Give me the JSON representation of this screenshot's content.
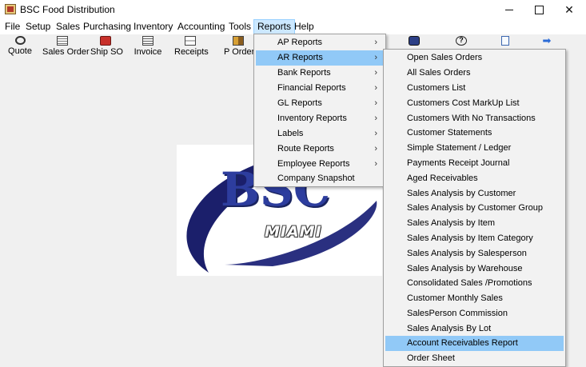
{
  "window": {
    "title": "BSC Food Distribution"
  },
  "menubar": {
    "items": [
      "File",
      "Setup",
      "Sales",
      "Purchasing",
      "Inventory",
      "Accounting",
      "Tools",
      "Reports",
      "Help"
    ],
    "active": "Reports"
  },
  "toolbar": {
    "items": [
      {
        "label": "Quote",
        "icon": "handshake-icon"
      },
      {
        "label": "Sales Order",
        "icon": "document-icon"
      },
      {
        "label": "Ship SO",
        "icon": "truck-icon"
      },
      {
        "label": "Invoice",
        "icon": "invoice-icon"
      },
      {
        "label": "Receipts",
        "icon": "receipt-icon"
      },
      {
        "label": "P Order",
        "icon": "purchase-order-icon"
      },
      {
        "label": "",
        "icon": "gear-icon"
      },
      {
        "label": "",
        "icon": "help-icon"
      },
      {
        "label": "",
        "icon": "page-icon"
      },
      {
        "label": "",
        "icon": "arrow-right-icon"
      }
    ]
  },
  "logo": {
    "main_text": "BSC",
    "sub_text": "MIAMI"
  },
  "reports_menu": {
    "items": [
      {
        "label": "AP Reports",
        "submenu": true
      },
      {
        "label": "AR Reports",
        "submenu": true,
        "highlighted": true
      },
      {
        "label": "Bank Reports",
        "submenu": true
      },
      {
        "label": "Financial Reports",
        "submenu": true
      },
      {
        "label": "GL Reports",
        "submenu": true
      },
      {
        "label": "Inventory Reports",
        "submenu": true
      },
      {
        "label": "Labels",
        "submenu": true
      },
      {
        "label": "Route Reports",
        "submenu": true
      },
      {
        "label": "Employee Reports",
        "submenu": true
      },
      {
        "label": "Company Snapshot",
        "submenu": false
      }
    ]
  },
  "ar_reports_menu": {
    "items": [
      {
        "label": "Open Sales Orders"
      },
      {
        "label": "All Sales Orders"
      },
      {
        "label": "Customers List"
      },
      {
        "label": "Customers Cost MarkUp List"
      },
      {
        "label": "Customers With No Transactions"
      },
      {
        "label": "Customer Statements"
      },
      {
        "label": "Simple Statement / Ledger"
      },
      {
        "label": "Payments Receipt Journal"
      },
      {
        "label": "Aged Receivables"
      },
      {
        "label": "Sales Analysis by Customer"
      },
      {
        "label": "Sales Analysis by Customer Group"
      },
      {
        "label": "Sales Analysis by Item"
      },
      {
        "label": "Sales Analysis by Item Category"
      },
      {
        "label": "Sales Analysis by Salesperson"
      },
      {
        "label": "Sales Analysis by Warehouse"
      },
      {
        "label": "Consolidated Sales /Promotions"
      },
      {
        "label": "Customer Monthly Sales"
      },
      {
        "label": "SalesPerson Commission"
      },
      {
        "label": "Sales Analysis By Lot"
      },
      {
        "label": "Account Receivables Report",
        "highlighted": true
      },
      {
        "label": "Order Sheet"
      }
    ]
  },
  "submenu_arrow": "›",
  "colors": {
    "menu_highlight": "#91c9f7",
    "menubar_active": "#cce8ff",
    "logo_blue": "#2d3d9e"
  }
}
